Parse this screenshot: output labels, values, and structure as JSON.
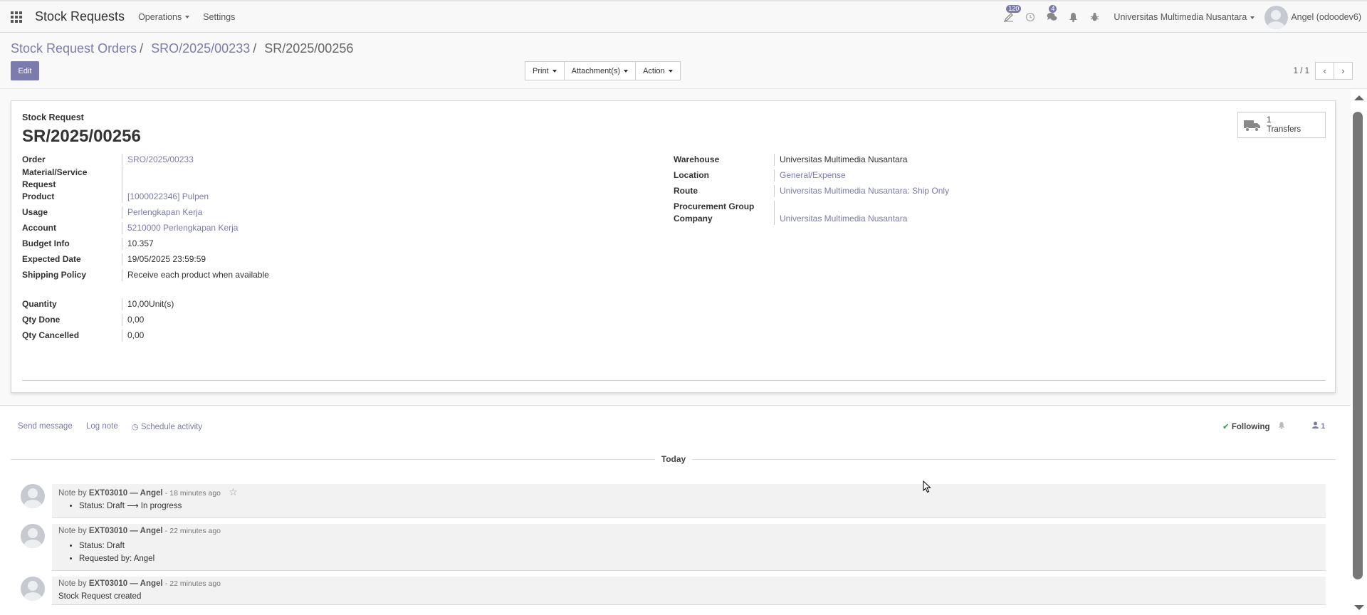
{
  "navbar": {
    "app_title": "Stock Requests",
    "menus": [
      "Operations",
      "Settings"
    ],
    "activity_count": "120",
    "messages_count": "4",
    "company": "Universitas Multimedia Nusantara",
    "user": "Angel (odoodev6)"
  },
  "breadcrumb": {
    "items": [
      "Stock Request Orders",
      "SRO/2025/00233"
    ],
    "current": "SR/2025/00256"
  },
  "control": {
    "edit_label": "Edit",
    "print_label": "Print",
    "attachments_label": "Attachment(s)",
    "action_label": "Action",
    "pager_value": "1 / 1"
  },
  "form": {
    "subtitle": "Stock Request",
    "title": "SR/2025/00256",
    "smart_button": {
      "count": "1",
      "label": "Transfers"
    },
    "left": {
      "order_label": "Order",
      "order_value": "SRO/2025/00233",
      "material_label": "Material/Service Request",
      "material_value": "",
      "product_label": "Product",
      "product_value": "[1000022346] Pulpen",
      "usage_label": "Usage",
      "usage_value": "Perlengkapan Kerja",
      "account_label": "Account",
      "account_value": "5210000 Perlengkapan Kerja",
      "budget_label": "Budget Info",
      "budget_value": "10.357",
      "expected_label": "Expected Date",
      "expected_value": "19/05/2025 23:59:59",
      "shipping_label": "Shipping Policy",
      "shipping_value": "Receive each product when available",
      "quantity_label": "Quantity",
      "quantity_value": "10,00Unit(s)",
      "qty_done_label": "Qty Done",
      "qty_done_value": "0,00",
      "qty_cancelled_label": "Qty Cancelled",
      "qty_cancelled_value": "0,00"
    },
    "right": {
      "warehouse_label": "Warehouse",
      "warehouse_value": "Universitas Multimedia Nusantara",
      "location_label": "Location",
      "location_value": "General/Expense",
      "route_label": "Route",
      "route_value": "Universitas Multimedia Nusantara: Ship Only",
      "procurement_label": "Procurement Group",
      "procurement_value": "",
      "company_label": "Company",
      "company_value": "Universitas Multimedia Nusantara"
    }
  },
  "chatter": {
    "send_message": "Send message",
    "log_note": "Log note",
    "schedule_activity": "Schedule activity",
    "following": "Following",
    "followers_count": "1",
    "date_separator": "Today",
    "messages": [
      {
        "prefix": "Note by",
        "author": "EXT03010 — Angel",
        "time": "- 18 minutes ago",
        "lines": [
          "Status: Draft ⟶ In progress"
        ]
      },
      {
        "prefix": "Note by",
        "author": "EXT03010 — Angel",
        "time": "- 22 minutes ago",
        "lines": [
          "Status: Draft",
          "Requested by: Angel"
        ]
      },
      {
        "prefix": "Note by",
        "author": "EXT03010 — Angel",
        "time": "- 22 minutes ago",
        "text": "Stock Request created"
      }
    ]
  }
}
